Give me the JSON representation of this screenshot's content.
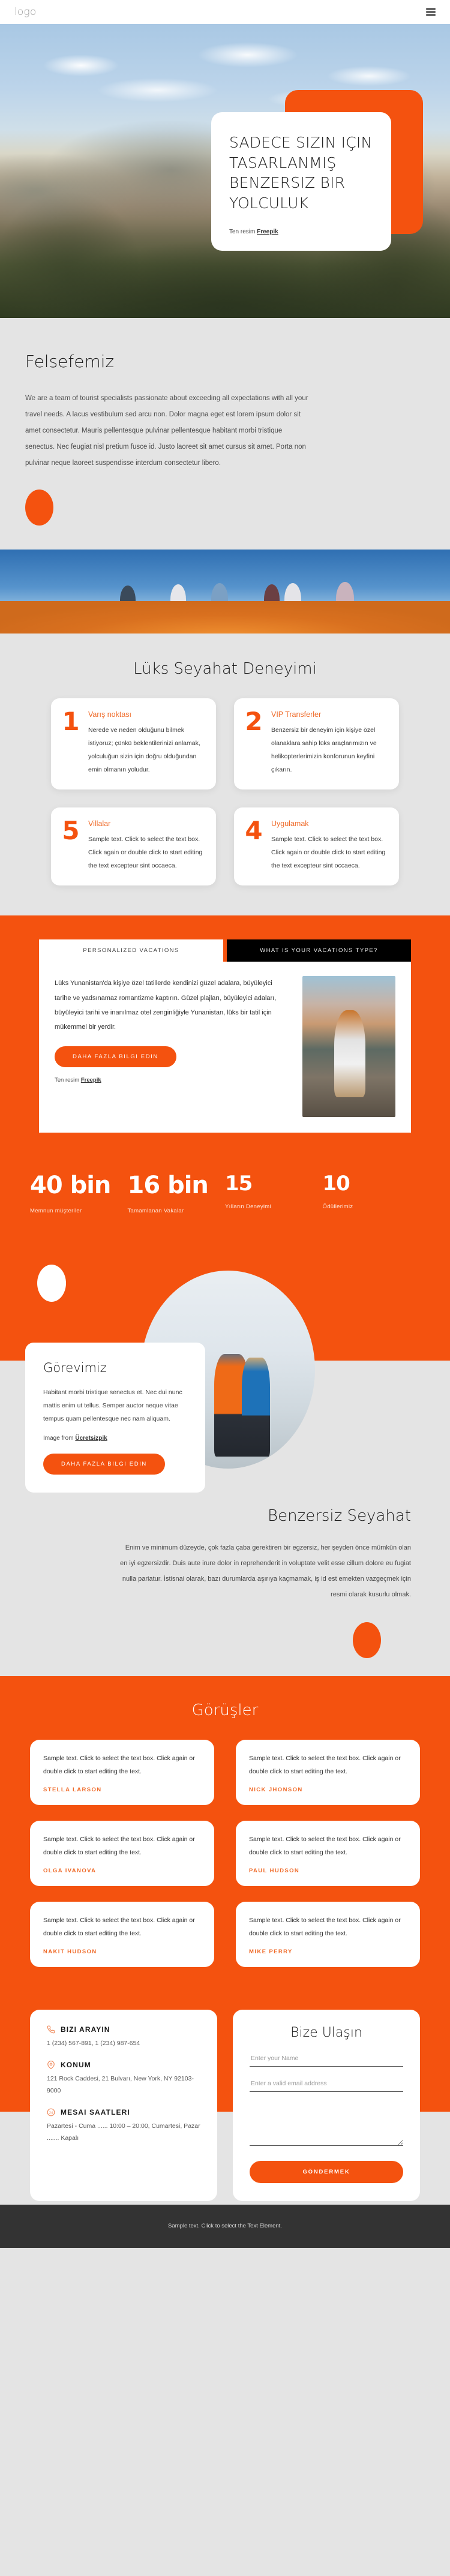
{
  "header": {
    "logo": "logo",
    "menu_icon": "hamburger-icon"
  },
  "hero": {
    "title": "SADECE SIZIN IÇIN TASARLANMIŞ BENZERSIZ BIR YOLCULUK",
    "credit_prefix": "Ten resim ",
    "credit_link": "Freepik"
  },
  "philosophy": {
    "heading": "Felsefemiz",
    "body": "We are a team of tourist specialists passionate about exceeding all expectations with all your travel needs. A lacus vestibulum sed arcu non. Dolor magna eget est lorem ipsum dolor sit amet consectetur. Mauris pellentesque pulvinar pellentesque habitant morbi tristique senectus. Nec feugiat nisl pretium fusce id. Justo laoreet sit amet cursus sit amet. Porta non pulvinar neque laoreet suspendisse interdum consectetur libero."
  },
  "luxury": {
    "heading": "Lüks Seyahat Deneyimi",
    "cards": [
      {
        "number": "1",
        "title": "Varış noktası",
        "text": "Nerede ve neden olduğunu bilmek istiyoruz; çünkü beklentilerinizi anlamak, yolculuğun sizin için doğru olduğundan emin olmanın yoludur."
      },
      {
        "number": "2",
        "title": "VIP Transferler",
        "text": "Benzersiz bir deneyim için kişiye özel olanaklara sahip lüks araçlarımızın ve helikopterlerimizin konforunun keyfini çıkarın."
      },
      {
        "number": "5",
        "title": "Villalar",
        "text": "Sample text. Click to select the text box. Click again or double click to start editing the text excepteur sint occaeca."
      },
      {
        "number": "4",
        "title": "Uygulamak",
        "text": "Sample text. Click to select the text box. Click again or double click to start editing the text excepteur sint occaeca."
      }
    ]
  },
  "vacations": {
    "tab_active": "PERSONALIZED VACATIONS",
    "tab_inactive": "WHAT IS YOUR VACATIONS TYPE?",
    "body": "Lüks Yunanistan'da kişiye özel tatillerde kendinizi güzel adalara, büyüleyici tarihe ve yadsınamaz romantizme kaptırın. Güzel plajları, büyüleyici adaları, büyüleyici tarihi ve inanılmaz otel zenginliğiyle Yunanistan, lüks bir tatil için mükemmel bir yerdir.",
    "cta": "DAHA FAZLA BILGI EDIN",
    "credit_prefix": "Ten resim ",
    "credit_link": "Freepik"
  },
  "stats": [
    {
      "value": "40 bin",
      "label": "Memnun müşteriler"
    },
    {
      "value": "16 bin",
      "label": "Tamamlanan Vakalar"
    },
    {
      "value": "15",
      "label": "Yılların Deneyimi"
    },
    {
      "value": "10",
      "label": "Ödüllerimiz"
    }
  ],
  "mission": {
    "heading": "Görevimiz",
    "body": "Habitant morbi tristique senectus et. Nec dui nunc mattis enim ut tellus. Semper auctor neque vitae tempus quam pellentesque nec nam aliquam.",
    "credit_prefix": "Image from ",
    "credit_link": "Ücretsizpik",
    "cta": "DAHA FAZLA BILGI EDIN"
  },
  "unique": {
    "heading": "Benzersiz Seyahat",
    "body": "Enim ve minimum düzeyde, çok fazla çaba gerektiren bir egzersiz, her şeyden önce mümkün olan en iyi egzersizdir. Duis aute irure dolor in reprehenderit in voluptate velit esse cillum dolore eu fugiat nulla pariatur. İstisnai olarak, bazı durumlarda aşırıya kaçmamak, iş id est emekten vazgeçmek için resmi olarak kusurlu olmak."
  },
  "testimonials": {
    "heading": "Görüşler",
    "items": [
      {
        "text": "Sample text. Click to select the text box. Click again or double click to start editing the text.",
        "name": "STELLA LARSON"
      },
      {
        "text": "Sample text. Click to select the text box. Click again or double click to start editing the text.",
        "name": "NICK JHONSON"
      },
      {
        "text": "Sample text. Click to select the text box. Click again or double click to start editing the text.",
        "name": "OLGA IVANOVA"
      },
      {
        "text": "Sample text. Click to select the text box. Click again or double click to start editing the text.",
        "name": "PAUL HUDSON"
      },
      {
        "text": "Sample text. Click to select the text box. Click again or double click to start editing the text.",
        "name": "NAKIT HUDSON"
      },
      {
        "text": "Sample text. Click to select the text box. Click again or double click to start editing the text.",
        "name": "MIKE PERRY"
      }
    ]
  },
  "contact_info": {
    "phone_title": "BIZI ARAYIN",
    "phone_icon": "phone-icon",
    "phone_value": "1 (234) 567-891, 1 (234) 987-654",
    "location_title": "KONUM",
    "location_icon": "map-pin-icon",
    "location_value": "121 Rock Caddesi, 21 Bulvarı, New York, NY 92103-9000",
    "hours_title": "MESAI SAATLERI",
    "hours_icon": "clock-24-icon",
    "hours_value": "Pazartesi - Cuma ...... 10:00 – 20:00, Cumartesi, Pazar ....... Kapalı"
  },
  "contact_form": {
    "heading": "Bize Ulaşın",
    "name_placeholder": "Enter your Name",
    "email_placeholder": "Enter a valid email address",
    "message_placeholder": "",
    "submit_label": "GÖNDERMEK"
  },
  "footer": {
    "text": "Sample text. Click to select the Text Element."
  },
  "colors": {
    "accent": "#f4520f",
    "page_bg": "#e4e4e4",
    "footer_bg": "#333333",
    "card_bg": "#ffffff"
  }
}
